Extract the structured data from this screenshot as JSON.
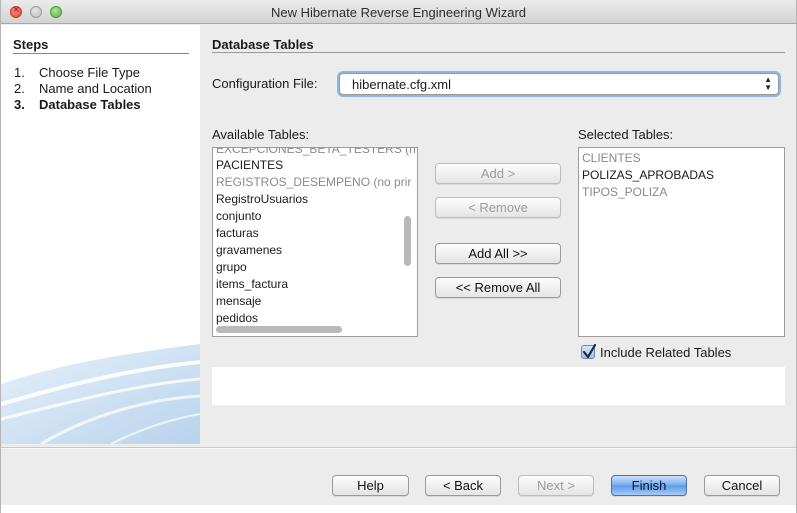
{
  "window": {
    "title": "New Hibernate Reverse Engineering Wizard"
  },
  "steps": {
    "title": "Steps",
    "items": [
      {
        "num": "1.",
        "label": "Choose File Type"
      },
      {
        "num": "2.",
        "label": "Name and Location"
      },
      {
        "num": "3.",
        "label": "Database Tables"
      }
    ]
  },
  "main": {
    "heading": "Database Tables",
    "config_label": "Configuration File:",
    "config_value": "hibernate.cfg.xml",
    "available_label": "Available Tables:",
    "available_tables": [
      {
        "name": "EXCEPCIONES_BETA_TESTERS (n",
        "dim": true
      },
      {
        "name": "PACIENTES",
        "dim": false
      },
      {
        "name": "REGISTROS_DESEMPENO (no prir",
        "dim": true
      },
      {
        "name": "RegistroUsuarios",
        "dim": false
      },
      {
        "name": "conjunto",
        "dim": false
      },
      {
        "name": "facturas",
        "dim": false
      },
      {
        "name": "gravamenes",
        "dim": false
      },
      {
        "name": "grupo",
        "dim": false
      },
      {
        "name": "items_factura",
        "dim": false
      },
      {
        "name": "mensaje",
        "dim": false
      },
      {
        "name": "pedidos",
        "dim": false
      }
    ],
    "selected_label": "Selected Tables:",
    "selected_tables": [
      {
        "name": "CLIENTES",
        "dim": true
      },
      {
        "name": "POLIZAS_APROBADAS",
        "dim": false
      },
      {
        "name": "TIPOS_POLIZA",
        "dim": true
      }
    ],
    "buttons": {
      "add": "Add >",
      "remove": "< Remove",
      "add_all": "Add All >>",
      "remove_all": "<< Remove All"
    },
    "include_related": {
      "label": "Include Related Tables",
      "checked": true
    }
  },
  "footer": {
    "help": "Help",
    "back": "< Back",
    "next": "Next >",
    "finish": "Finish",
    "cancel": "Cancel"
  },
  "colors": {
    "accent": "#5b98ea",
    "dim_text": "#8a8a8a"
  }
}
